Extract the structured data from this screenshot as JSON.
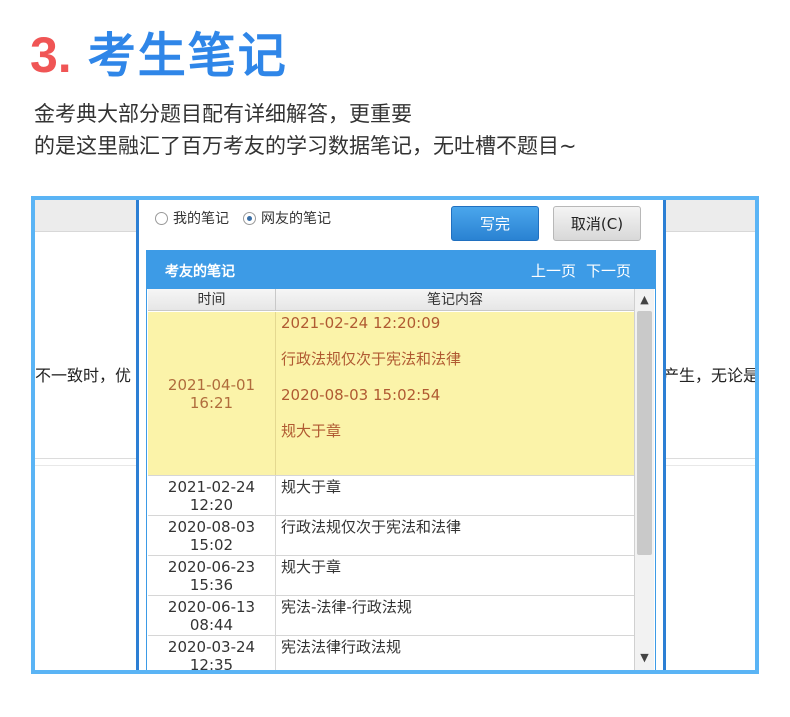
{
  "heading": {
    "number": "3.",
    "title": "考生笔记"
  },
  "description": {
    "line1": "金考典大部分题目配有详细解答，更重要",
    "line2": "的是这里融汇了百万考友的学习数据笔记，无吐槽不题目~"
  },
  "background": {
    "left_text": "不一致时，优",
    "right_text": "产生，无论是"
  },
  "dialog": {
    "radio_mine": "我的笔记",
    "radio_friends": "网友的笔记",
    "write_button": "写完",
    "cancel_button": "取消(C)",
    "panel_title": "考友的笔记",
    "prev_page": "上一页",
    "next_page": "下一页",
    "columns": {
      "time": "时间",
      "content": "笔记内容"
    },
    "highlight_row": {
      "date": "2021-04-01",
      "time": "16:21",
      "entries": [
        {
          "timestamp": "2021-02-24 12:20:09",
          "text": "行政法规仅次于宪法和法律"
        },
        {
          "timestamp": "2020-08-03 15:02:54",
          "text": "规大于章"
        }
      ]
    },
    "rows": [
      {
        "date": "2021-02-24",
        "time": "12:20",
        "content": "规大于章"
      },
      {
        "date": "2020-08-03",
        "time": "15:02",
        "content": "行政法规仅次于宪法和法律"
      },
      {
        "date": "2020-06-23",
        "time": "15:36",
        "content": "规大于章"
      },
      {
        "date": "2020-06-13",
        "time": "08:44",
        "content": "宪法-法律-行政法规"
      },
      {
        "date": "2020-03-24",
        "time": "12:35",
        "content": "宪法法律行政法规"
      }
    ]
  }
}
